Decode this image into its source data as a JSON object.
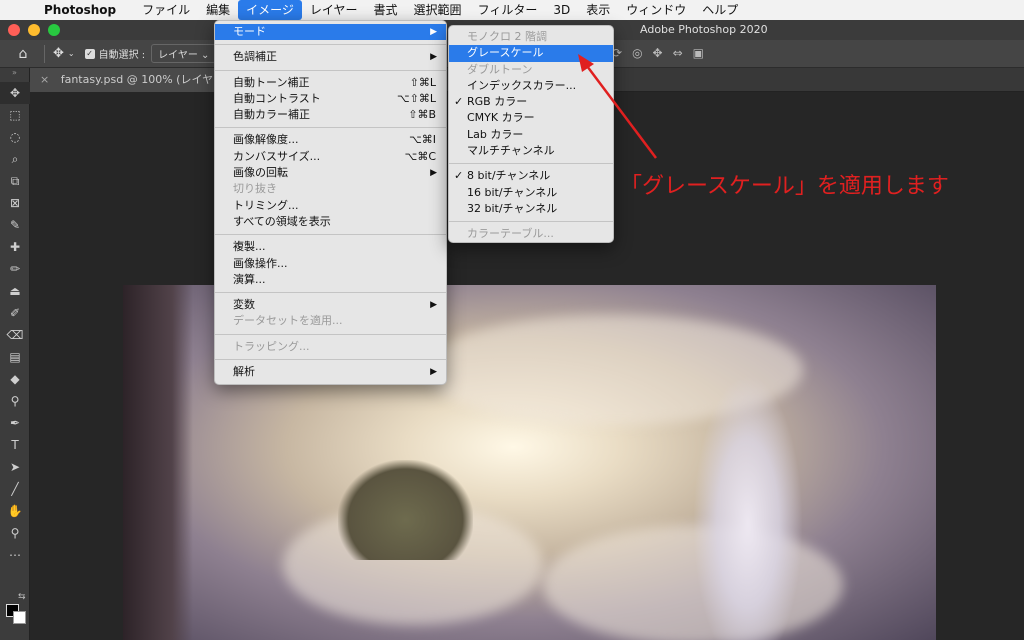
{
  "menubar": {
    "app": "Photoshop",
    "items": [
      "ファイル",
      "編集",
      "イメージ",
      "レイヤー",
      "書式",
      "選択範囲",
      "フィルター",
      "3D",
      "表示",
      "ウィンドウ",
      "ヘルプ"
    ],
    "active_index": 2
  },
  "window": {
    "title": "Adobe Photoshop 2020"
  },
  "options": {
    "auto_select_label": "自動選択 :",
    "layer_dropdown": "レイヤー ⌄"
  },
  "document_tab": {
    "label": "fantasy.psd @ 100% (レイヤー 0, ",
    "close": "×"
  },
  "image_menu": {
    "groups": [
      [
        {
          "label": "モード",
          "submenu": true,
          "selected": true
        }
      ],
      [
        {
          "label": "色調補正",
          "submenu": true
        }
      ],
      [
        {
          "label": "自動トーン補正",
          "shortcut": "⇧⌘L"
        },
        {
          "label": "自動コントラスト",
          "shortcut": "⌥⇧⌘L"
        },
        {
          "label": "自動カラー補正",
          "shortcut": "⇧⌘B"
        }
      ],
      [
        {
          "label": "画像解像度...",
          "shortcut": "⌥⌘I"
        },
        {
          "label": "カンバスサイズ...",
          "shortcut": "⌥⌘C"
        },
        {
          "label": "画像の回転",
          "submenu": true
        },
        {
          "label": "切り抜き",
          "disabled": true
        },
        {
          "label": "トリミング..."
        },
        {
          "label": "すべての領域を表示"
        }
      ],
      [
        {
          "label": "複製..."
        },
        {
          "label": "画像操作..."
        },
        {
          "label": "演算..."
        }
      ],
      [
        {
          "label": "変数",
          "submenu": true
        },
        {
          "label": "データセットを適用...",
          "disabled": true
        }
      ],
      [
        {
          "label": "トラッピング...",
          "disabled": true
        }
      ],
      [
        {
          "label": "解析",
          "submenu": true
        }
      ]
    ]
  },
  "mode_menu": {
    "groups": [
      [
        {
          "label": "モノクロ 2 階調",
          "disabled": true
        },
        {
          "label": "グレースケール",
          "selected": true
        },
        {
          "label": "ダブルトーン",
          "disabled": true
        },
        {
          "label": "インデックスカラー..."
        },
        {
          "label": "RGB カラー",
          "checked": true
        },
        {
          "label": "CMYK カラー"
        },
        {
          "label": "Lab カラー"
        },
        {
          "label": "マルチチャンネル"
        }
      ],
      [
        {
          "label": "8 bit/チャンネル",
          "checked": true
        },
        {
          "label": "16 bit/チャンネル"
        },
        {
          "label": "32 bit/チャンネル"
        }
      ],
      [
        {
          "label": "カラーテーブル...",
          "disabled": true
        }
      ]
    ]
  },
  "annotation": {
    "text": "「グレースケール」を適用します",
    "color": "#e02020"
  },
  "icons": {
    "home": "⌂",
    "move": "✥",
    "check": "✓",
    "submenu_arrow": "▶",
    "chevron": "»",
    "tools": [
      "✥",
      "⬚",
      "◌",
      "⌕",
      "⧉",
      "⊠",
      "✎",
      "✚",
      "✏",
      "⏏",
      "✐",
      "⌫",
      "▤",
      "◆",
      "⚲",
      "✒",
      "T",
      "➤",
      "╱",
      "✋",
      "⚲",
      "⋯"
    ]
  }
}
